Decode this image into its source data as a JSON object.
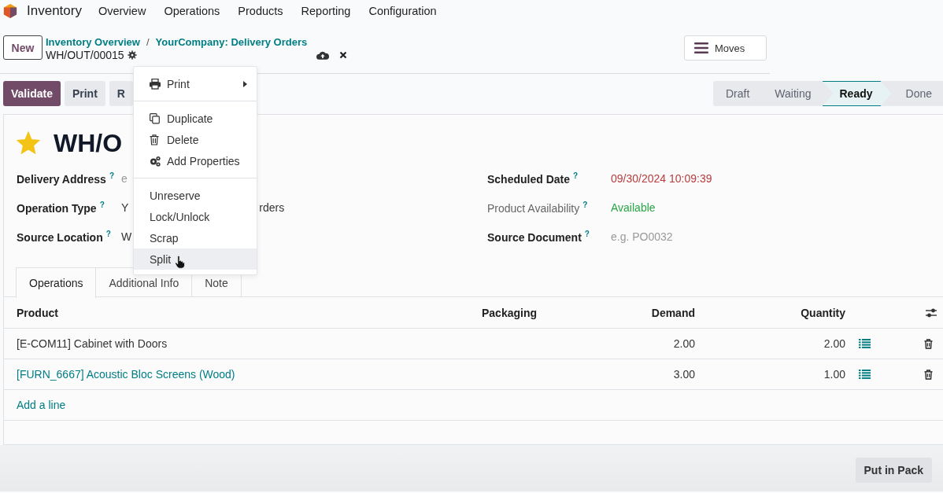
{
  "navbar": {
    "app": "Inventory",
    "menus": [
      "Overview",
      "Operations",
      "Products",
      "Reporting",
      "Configuration"
    ]
  },
  "control_panel": {
    "new_button": "New",
    "breadcrumbs": [
      "Inventory Overview",
      "YourCompany: Delivery Orders"
    ],
    "separator": "/",
    "record": "WH/OUT/00015",
    "smart_button": "Moves"
  },
  "actions": [
    {
      "label": "Validate",
      "kind": "primary"
    },
    {
      "label": "Print",
      "kind": "secondary"
    },
    {
      "label": "R",
      "kind": "secondary"
    }
  ],
  "statusbar": [
    {
      "label": "Draft",
      "selected": false
    },
    {
      "label": "Waiting",
      "selected": false
    },
    {
      "label": "Ready",
      "selected": true
    },
    {
      "label": "Done",
      "selected": false
    }
  ],
  "form": {
    "title": "WH/O",
    "starred": true,
    "left_fields": [
      {
        "label": "Delivery Address",
        "help": "?",
        "value_parts": [
          "e"
        ],
        "kind": "placeholder"
      },
      {
        "label": "Operation Type",
        "help": "?",
        "value_parts": [
          "Y",
          "rders"
        ],
        "kind": "value"
      },
      {
        "label": "Source Location",
        "help": "?",
        "value_parts": [
          "W"
        ],
        "kind": "value"
      }
    ],
    "right_fields": [
      {
        "label": "Scheduled Date",
        "help": "?",
        "value": "09/30/2024 10:09:39",
        "kind": "overdue",
        "muted": false
      },
      {
        "label": "Product Availability",
        "help": "?",
        "value": "Available",
        "kind": "success",
        "muted": true
      },
      {
        "label": "Source Document",
        "help": "?",
        "value": "e.g. PO0032",
        "kind": "placeholder",
        "muted": false
      }
    ]
  },
  "tabs": [
    {
      "label": "Operations",
      "selected": true
    },
    {
      "label": "Additional Info",
      "selected": false
    },
    {
      "label": "Note",
      "selected": false
    }
  ],
  "table": {
    "columns": [
      "Product",
      "Packaging",
      "Demand",
      "Quantity"
    ],
    "rows": [
      {
        "product": "[E-COM11] Cabinet with Doors",
        "link": false,
        "demand": "2.00",
        "quantity": "2.00"
      },
      {
        "product": "[FURN_6667] Acoustic Bloc Screens (Wood)",
        "link": true,
        "demand": "3.00",
        "quantity": "1.00"
      }
    ],
    "add_line": "Add a line"
  },
  "footer_button": "Put in Pack",
  "menu": {
    "sections": [
      [
        {
          "label": "Print",
          "submenu": true,
          "highlighted": false
        }
      ],
      [
        {
          "label": "Duplicate",
          "submenu": false,
          "highlighted": false
        },
        {
          "label": "Delete",
          "submenu": false,
          "highlighted": false
        },
        {
          "label": "Add Properties",
          "submenu": false,
          "highlighted": false
        }
      ],
      [
        {
          "label": "Unreserve",
          "submenu": false,
          "highlighted": false
        },
        {
          "label": "Lock/Unlock",
          "submenu": false,
          "highlighted": false
        },
        {
          "label": "Scrap",
          "submenu": false,
          "highlighted": false
        },
        {
          "label": "Split",
          "submenu": false,
          "highlighted": true
        }
      ]
    ]
  }
}
